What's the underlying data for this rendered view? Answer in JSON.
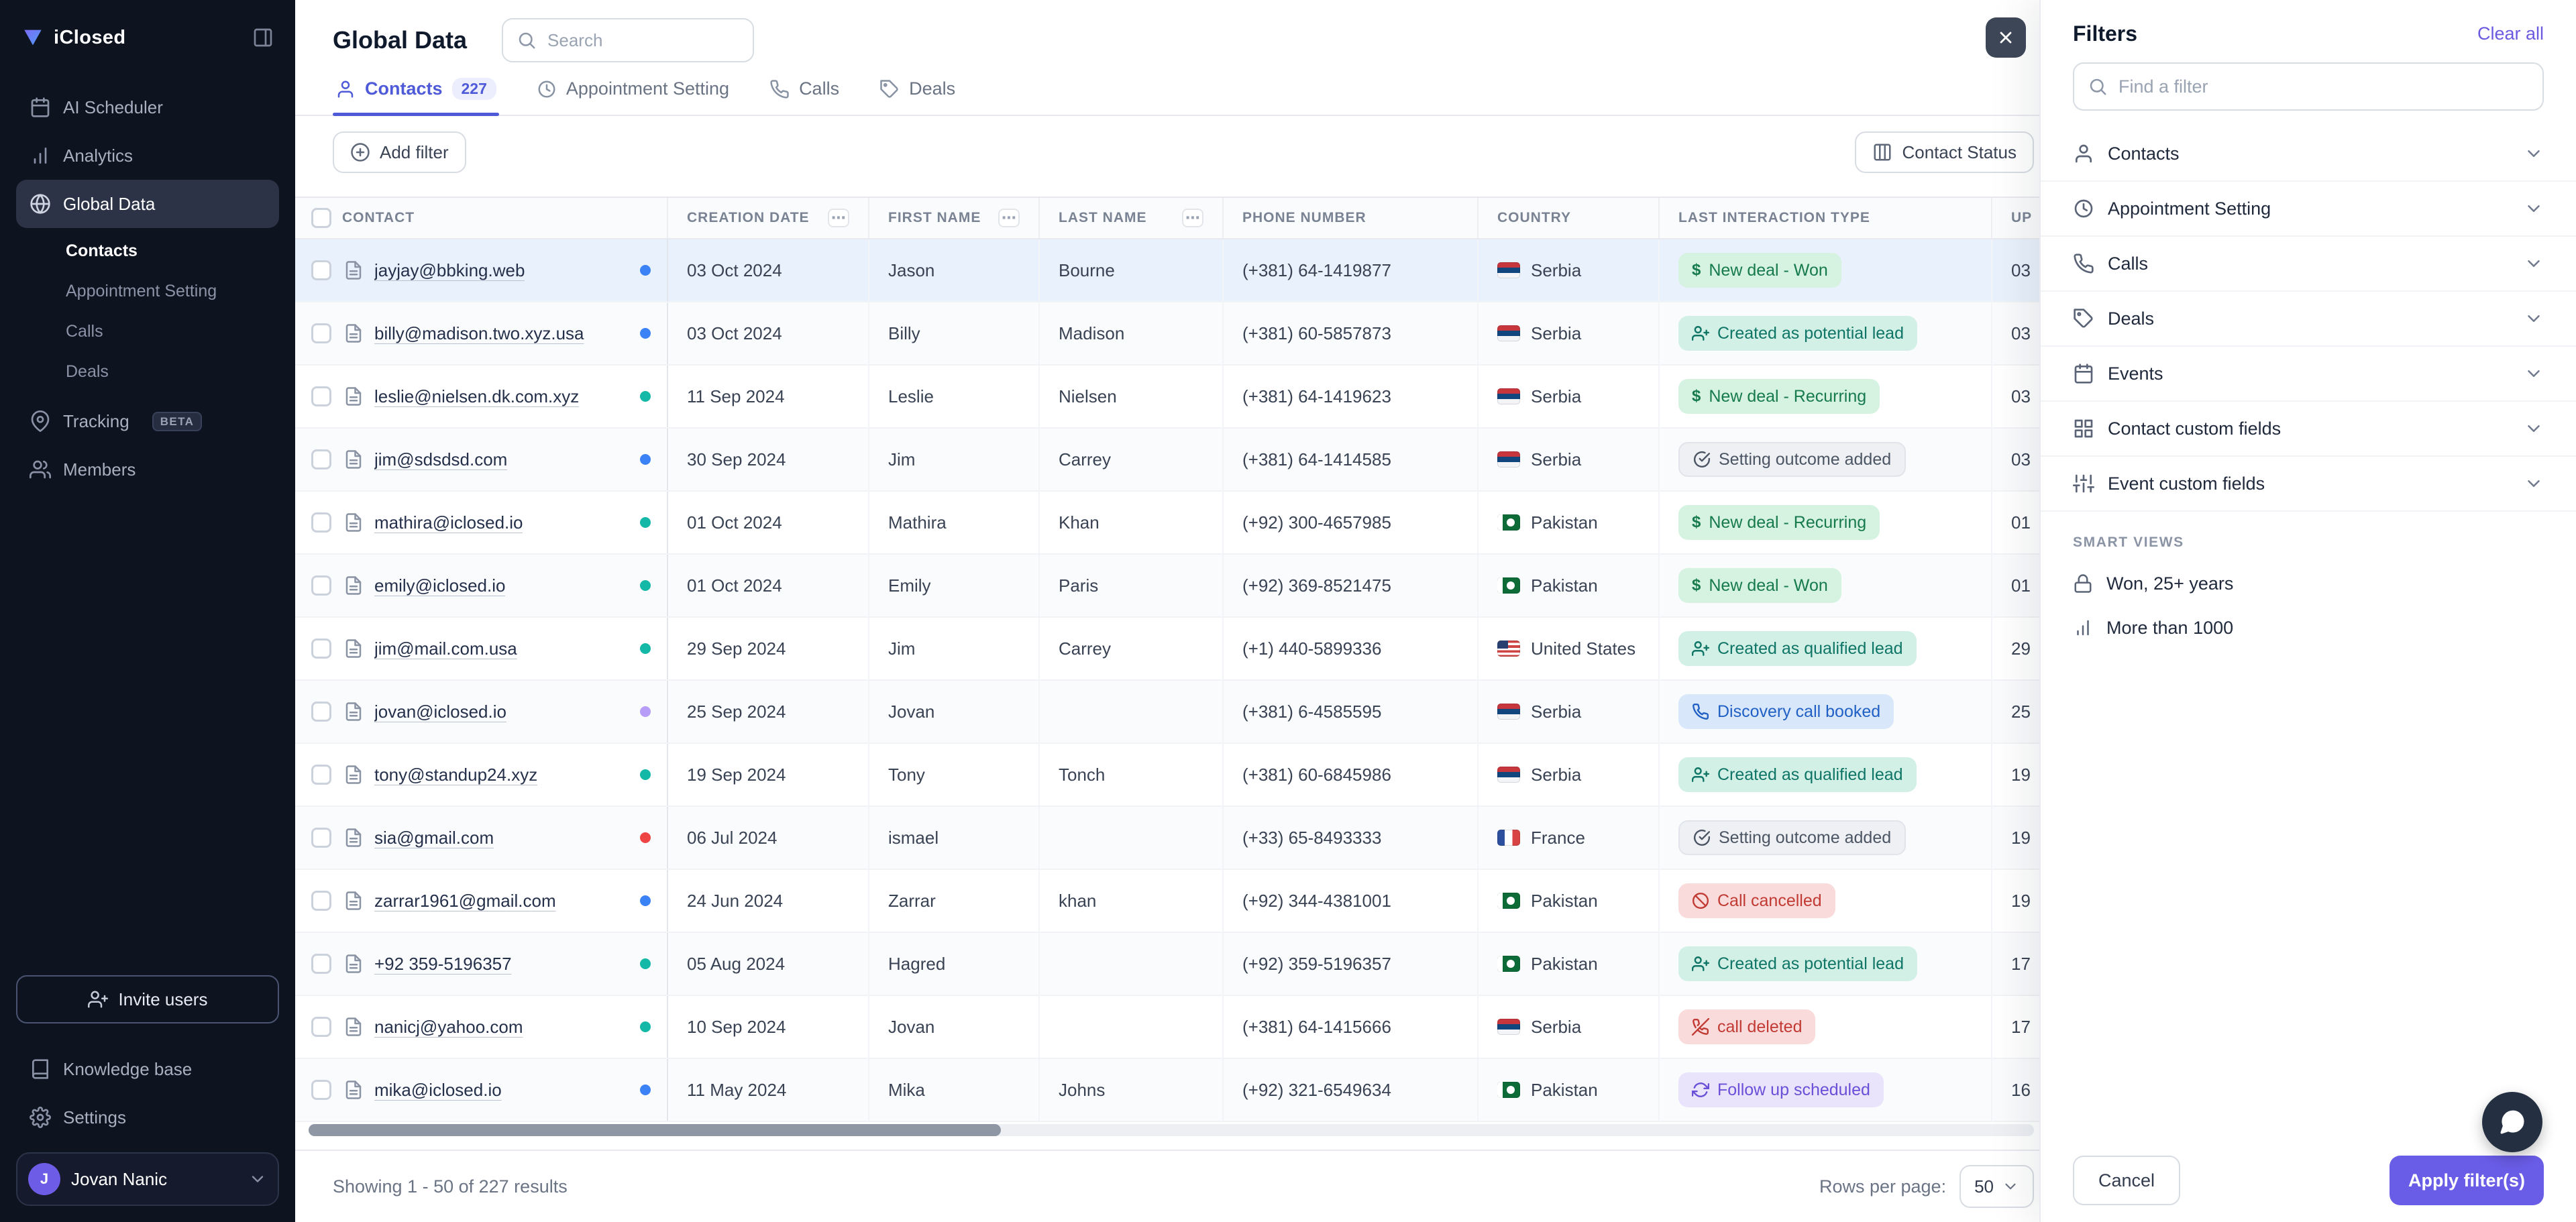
{
  "brand": {
    "name": "iClosed",
    "accent_color": "#695ce6",
    "sidebar_bg": "#0e1320"
  },
  "sidebar": {
    "items": [
      {
        "label": "AI Scheduler",
        "icon": "calendar-icon"
      },
      {
        "label": "Analytics",
        "icon": "bar-chart-icon"
      },
      {
        "label": "Global Data",
        "icon": "globe-icon",
        "active": true,
        "children": [
          "Contacts",
          "Appointment Setting",
          "Calls",
          "Deals"
        ],
        "active_child": "Contacts"
      },
      {
        "label": "Tracking",
        "icon": "map-pin-icon",
        "badge": "BETA"
      },
      {
        "label": "Members",
        "icon": "users-icon"
      }
    ],
    "invite_button": "Invite users",
    "footer_items": [
      {
        "label": "Knowledge base",
        "icon": "book-icon"
      },
      {
        "label": "Settings",
        "icon": "gear-icon"
      }
    ],
    "user": {
      "name": "Jovan Nanic",
      "avatar_initial": "J"
    }
  },
  "header": {
    "title": "Global Data",
    "search_placeholder": "Search",
    "tabs": [
      {
        "label": "Contacts",
        "icon": "user-icon",
        "count": "227",
        "active": true
      },
      {
        "label": "Appointment Setting",
        "icon": "clock-icon"
      },
      {
        "label": "Calls",
        "icon": "phone-icon"
      },
      {
        "label": "Deals",
        "icon": "tag-icon"
      }
    ]
  },
  "toolbar": {
    "add_filter": "Add filter",
    "contact_status": "Contact Status"
  },
  "table": {
    "columns": [
      {
        "label": "CONTACT"
      },
      {
        "label": "CREATION DATE",
        "menu": true
      },
      {
        "label": "FIRST NAME",
        "menu": true
      },
      {
        "label": "LAST NAME",
        "menu": true
      },
      {
        "label": "PHONE NUMBER"
      },
      {
        "label": "COUNTRY"
      },
      {
        "label": "LAST INTERACTION TYPE"
      },
      {
        "label": "UP"
      }
    ],
    "rows": [
      {
        "email": "jayjay@bbking.web",
        "dot": "#3b82f6",
        "date": "03 Oct 2024",
        "first": "Jason",
        "last": "Bourne",
        "phone": "(+381) 64-1419877",
        "country": "Serbia",
        "flag": "rs",
        "interaction": {
          "label": "New deal - Won",
          "variant": "green",
          "icon": "dollar"
        },
        "up": "03",
        "highlight": true
      },
      {
        "email": "billy@madison.two.xyz.usa",
        "dot": "#3b82f6",
        "date": "03 Oct 2024",
        "first": "Billy",
        "last": "Madison",
        "phone": "(+381) 60-5857873",
        "country": "Serbia",
        "flag": "rs",
        "interaction": {
          "label": "Created as potential lead",
          "variant": "teal",
          "icon": "user-plus"
        },
        "up": "03"
      },
      {
        "email": "leslie@nielsen.dk.com.xyz",
        "dot": "#14b8a6",
        "date": "11 Sep 2024",
        "first": "Leslie",
        "last": "Nielsen",
        "phone": "(+381) 64-1419623",
        "country": "Serbia",
        "flag": "rs",
        "interaction": {
          "label": "New deal - Recurring",
          "variant": "green",
          "icon": "dollar"
        },
        "up": "03"
      },
      {
        "email": "jim@sdsdsd.com",
        "dot": "#3b82f6",
        "date": "30 Sep 2024",
        "first": "Jim",
        "last": "Carrey",
        "phone": "(+381) 64-1414585",
        "country": "Serbia",
        "flag": "rs",
        "interaction": {
          "label": "Setting outcome added",
          "variant": "gray",
          "icon": "check-circle"
        },
        "up": "03"
      },
      {
        "email": "mathira@iclosed.io",
        "dot": "#14b8a6",
        "date": "01 Oct 2024",
        "first": "Mathira",
        "last": "Khan",
        "phone": "(+92) 300-4657985",
        "country": "Pakistan",
        "flag": "pk",
        "interaction": {
          "label": "New deal - Recurring",
          "variant": "green",
          "icon": "dollar"
        },
        "up": "01"
      },
      {
        "email": "emily@iclosed.io",
        "dot": "#14b8a6",
        "date": "01 Oct 2024",
        "first": "Emily",
        "last": "Paris",
        "phone": "(+92) 369-8521475",
        "country": "Pakistan",
        "flag": "pk",
        "interaction": {
          "label": "New deal - Won",
          "variant": "green",
          "icon": "dollar"
        },
        "up": "01"
      },
      {
        "email": "jim@mail.com.usa",
        "dot": "#14b8a6",
        "date": "29 Sep 2024",
        "first": "Jim",
        "last": "Carrey",
        "phone": "(+1) 440-5899336",
        "country": "United States",
        "flag": "us",
        "interaction": {
          "label": "Created as qualified lead",
          "variant": "teal",
          "icon": "user-plus"
        },
        "up": "29"
      },
      {
        "email": "jovan@iclosed.io",
        "dot": "#b79df8",
        "date": "25 Sep 2024",
        "first": "Jovan",
        "last": "",
        "phone": "(+381) 6-4585595",
        "country": "Serbia",
        "flag": "rs",
        "interaction": {
          "label": "Discovery call booked",
          "variant": "blue",
          "icon": "phone"
        },
        "up": "25"
      },
      {
        "email": "tony@standup24.xyz",
        "dot": "#14b8a6",
        "date": "19 Sep 2024",
        "first": "Tony",
        "last": "Tonch",
        "phone": "(+381) 60-6845986",
        "country": "Serbia",
        "flag": "rs",
        "interaction": {
          "label": "Created as qualified lead",
          "variant": "teal",
          "icon": "user-plus"
        },
        "up": "19"
      },
      {
        "email": "sia@gmail.com",
        "dot": "#ef4444",
        "date": "06 Jul 2024",
        "first": "ismael",
        "last": "",
        "phone": "(+33) 65-8493333",
        "country": "France",
        "flag": "fr",
        "interaction": {
          "label": "Setting outcome added",
          "variant": "gray",
          "icon": "check-circle"
        },
        "up": "19"
      },
      {
        "email": "zarrar1961@gmail.com",
        "dot": "#3b82f6",
        "date": "24 Jun 2024",
        "first": "Zarrar",
        "last": "khan",
        "phone": "(+92) 344-4381001",
        "country": "Pakistan",
        "flag": "pk",
        "interaction": {
          "label": "Call cancelled",
          "variant": "red",
          "icon": "ban"
        },
        "up": "19"
      },
      {
        "email": "+92 359-5196357",
        "dot": "#14b8a6",
        "date": "05 Aug 2024",
        "first": "Hagred",
        "last": "",
        "phone": "(+92) 359-5196357",
        "country": "Pakistan",
        "flag": "pk",
        "interaction": {
          "label": "Created as potential lead",
          "variant": "teal",
          "icon": "user-plus"
        },
        "up": "17"
      },
      {
        "email": "nanicj@yahoo.com",
        "dot": "#14b8a6",
        "date": "10 Sep 2024",
        "first": "Jovan",
        "last": "",
        "phone": "(+381) 64-1415666",
        "country": "Serbia",
        "flag": "rs",
        "interaction": {
          "label": "call deleted",
          "variant": "red",
          "icon": "phone-x"
        },
        "up": "17"
      },
      {
        "email": "mika@iclosed.io",
        "dot": "#3b82f6",
        "date": "11 May 2024",
        "first": "Mika",
        "last": "Johns",
        "phone": "(+92) 321-6549634",
        "country": "Pakistan",
        "flag": "pk",
        "interaction": {
          "label": "Follow up scheduled",
          "variant": "purple",
          "icon": "refresh"
        },
        "up": "16"
      }
    ]
  },
  "footer": {
    "results": "Showing 1 - 50 of 227 results",
    "rows_per_page_label": "Rows per page:",
    "rows_per_page": "50"
  },
  "filters": {
    "title": "Filters",
    "clear_all": "Clear all",
    "search_placeholder": "Find a filter",
    "groups": [
      {
        "label": "Contacts",
        "icon": "user-icon"
      },
      {
        "label": "Appointment Setting",
        "icon": "clock-icon"
      },
      {
        "label": "Calls",
        "icon": "phone-icon"
      },
      {
        "label": "Deals",
        "icon": "tag-icon"
      },
      {
        "label": "Events",
        "icon": "calendar-icon"
      },
      {
        "label": "Contact custom fields",
        "icon": "grid-icon"
      },
      {
        "label": "Event custom fields",
        "icon": "sliders-icon"
      }
    ],
    "smart_views_label": "SMART VIEWS",
    "smart_views": [
      {
        "label": "Won, 25+ years",
        "icon": "lock-icon"
      },
      {
        "label": "More than 1000",
        "icon": "bar-chart-icon"
      }
    ],
    "cancel": "Cancel",
    "apply": "Apply filter(s)"
  }
}
